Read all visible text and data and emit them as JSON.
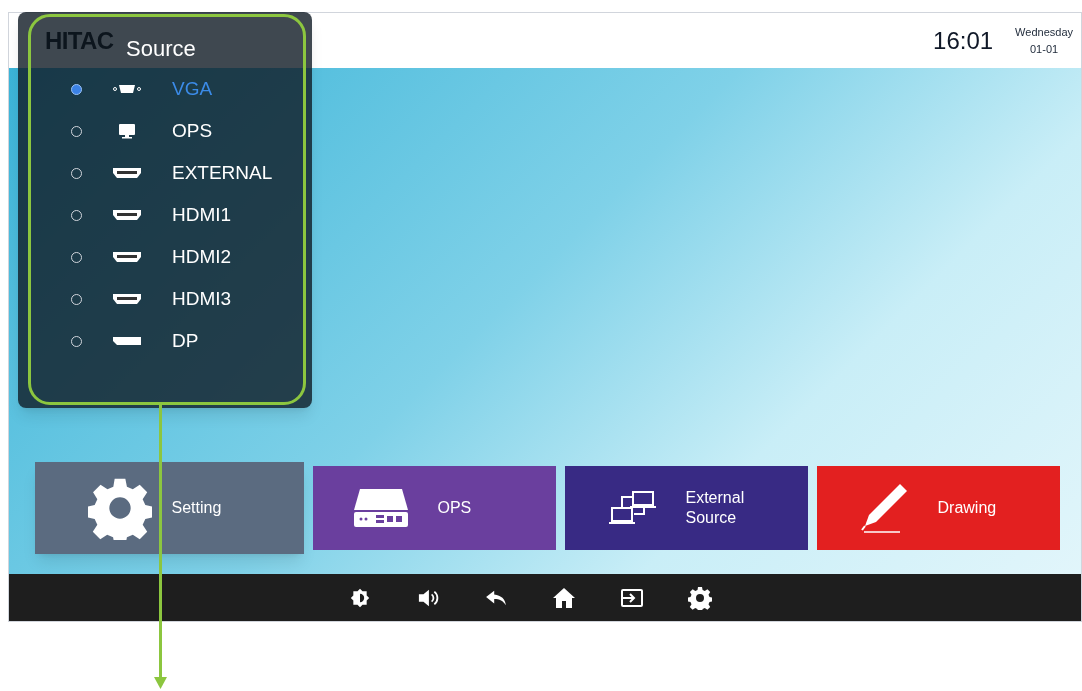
{
  "top_bar": {
    "logo": "HITAC",
    "time": "16:01",
    "weekday": "Wednesday",
    "date": "01-01"
  },
  "source_menu": {
    "title": "Source",
    "items": [
      {
        "label": "VGA",
        "kind": "vga",
        "selected": true
      },
      {
        "label": "OPS",
        "kind": "monitor",
        "selected": false
      },
      {
        "label": "EXTERNAL",
        "kind": "hdmi",
        "selected": false
      },
      {
        "label": "HDMI1",
        "kind": "hdmi",
        "selected": false
      },
      {
        "label": "HDMI2",
        "kind": "hdmi",
        "selected": false
      },
      {
        "label": "HDMI3",
        "kind": "hdmi",
        "selected": false
      },
      {
        "label": "DP",
        "kind": "dp",
        "selected": false
      }
    ]
  },
  "tiles": [
    {
      "label": "Setting",
      "kind": "gear",
      "color": "#5b6b80",
      "selected": true
    },
    {
      "label": "OPS",
      "kind": "ops",
      "color": "#6a3f9e",
      "selected": false
    },
    {
      "label": "External Source",
      "kind": "network",
      "color": "#382a84",
      "selected": false
    },
    {
      "label": "Drawing",
      "kind": "pen",
      "color": "#e32020",
      "selected": false
    }
  ],
  "nav_bar": [
    {
      "kind": "brightness"
    },
    {
      "kind": "volume"
    },
    {
      "kind": "back"
    },
    {
      "kind": "home"
    },
    {
      "kind": "input"
    },
    {
      "kind": "settings"
    }
  ]
}
